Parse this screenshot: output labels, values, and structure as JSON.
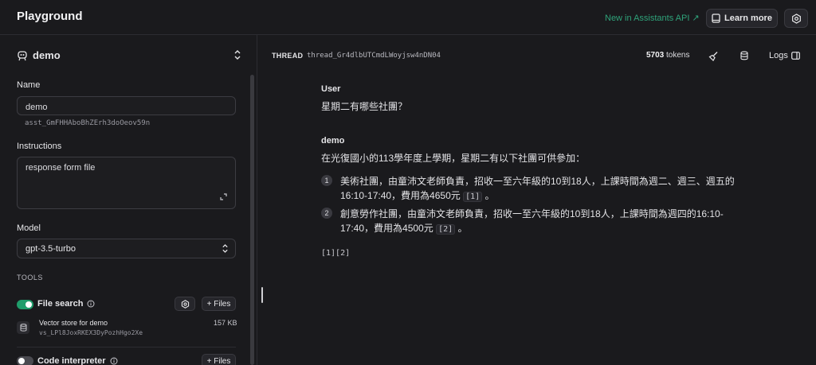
{
  "header": {
    "title": "Playground",
    "new_link": "New in Assistants API ↗",
    "learn_more": "Learn more"
  },
  "assistant": {
    "name_display": "demo",
    "name_label": "Name",
    "name_value": "demo",
    "id": "asst_GmFHHAboBhZErh3doOeov59n",
    "instructions_label": "Instructions",
    "instructions_value": "response form file",
    "model_label": "Model",
    "model_value": "gpt-3.5-turbo",
    "tools_label": "TOOLS",
    "tools": [
      {
        "name": "File search",
        "enabled": true,
        "files_label": "+ Files"
      },
      {
        "name": "Code interpreter",
        "enabled": false,
        "files_label": "+ Files"
      }
    ],
    "vector_store": {
      "name": "Vector store for demo",
      "id": "vs_LPl8JoxRKEX3DyPozhHgo2Xe",
      "size": "157 KB"
    }
  },
  "thread": {
    "label": "THREAD",
    "id": "thread_Gr4dlbUTCmdLWoyjsw4nDN04",
    "tokens_count": "5703",
    "tokens_unit": "tokens",
    "logs_label": "Logs"
  },
  "messages": {
    "user_role": "User",
    "user_text": "星期二有哪些社團？",
    "assistant_role": "demo",
    "assistant_intro": "在光復國小的113學年度上學期，星期二有以下社團可供參加：",
    "items": [
      {
        "num": "1",
        "text_1": "美術社團，由童沛文老師負責，招收一至六年級的10到18人，上課時間為週二、週三、週五的",
        "text_2": "16:10-17:40，費用為4650元",
        "cite": "[1]",
        "end": "。"
      },
      {
        "num": "2",
        "text_1": "創意勞作社團，由童沛文老師負責，招收一至六年級的10到18人，上課時間為週四的16:10-",
        "text_2": "17:40，費用為4500元",
        "cite": "[2]",
        "end": "。"
      }
    ],
    "refs": "[1][2]"
  }
}
